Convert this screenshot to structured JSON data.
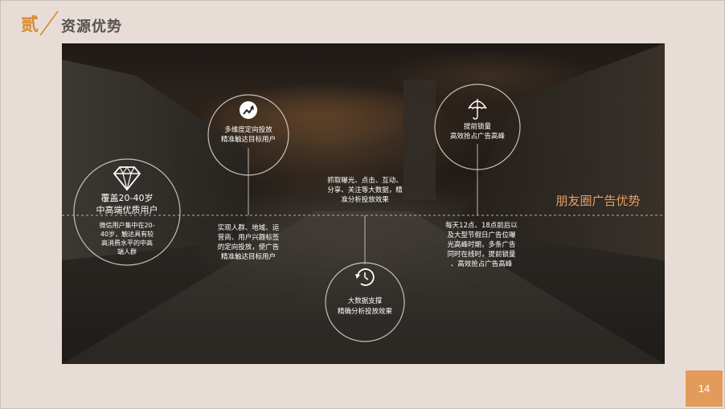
{
  "header": {
    "section_char": "贰",
    "title": "资源优势"
  },
  "colors": {
    "accent": "#d9892f",
    "title": "#555150",
    "highlight": "#e2a064",
    "badge": "#e29b5a"
  },
  "nodes": [
    {
      "id": "coverage",
      "icon": "diamond-icon",
      "title_line1": "覆盖20-40岁",
      "title_line2": "中高端优质用户",
      "desc": [
        "微信用户集中在20-",
        "40岁，触达具有较",
        "高消费水平的中高",
        "端人群"
      ]
    },
    {
      "id": "targeting",
      "icon": "growth-arrow-icon",
      "title_line1": "多维度定向投放",
      "title_line2": "精准触达目标用户"
    },
    {
      "id": "bigdata",
      "icon": "clock-history-icon",
      "title_line1": "大数据支撑",
      "title_line2": "精确分析投放效果"
    },
    {
      "id": "peak",
      "icon": "umbrella-icon",
      "title_line1": "提前锁量",
      "title_line2": "高效抢占广告高峰"
    }
  ],
  "texts": {
    "targeting_desc": [
      "实现人群、地域、运",
      "营商、用户兴趣标签",
      "的定向投放，使广告",
      "精准触达目标用户"
    ],
    "bigdata_desc": [
      "抓取曝光、点击、互动、",
      "分享、关注等大数据，精",
      "准分析投放效果"
    ],
    "peak_desc": [
      "每天12点、18点前后以",
      "及大型节假日广告位曝",
      "光高峰时期，多条广告",
      "同时在线时，提前锁量",
      "、高效抢占广告高峰"
    ]
  },
  "highlight_title": "朋友圈广告优势",
  "page_number": "14"
}
